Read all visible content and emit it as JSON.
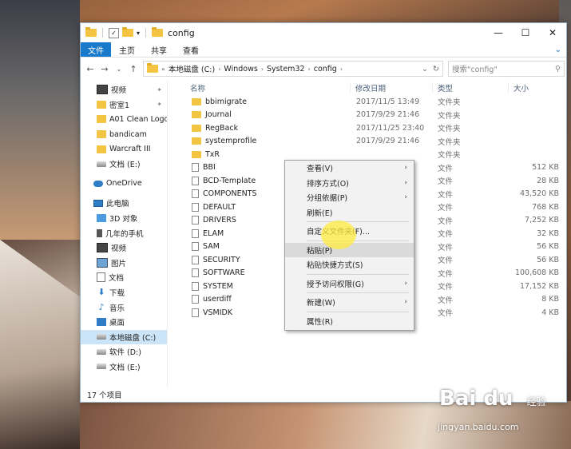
{
  "window": {
    "title": "config",
    "ribbon_tabs": [
      "主页",
      "共享",
      "查看"
    ],
    "file_tab": "文件",
    "controls": {
      "minimize": "—",
      "maximize": "☐",
      "close": "✕"
    }
  },
  "address": {
    "crumbs": [
      "本地磁盘 (C:)",
      "Windows",
      "System32",
      "config"
    ],
    "search_placeholder": "搜索\"config\""
  },
  "columns": {
    "name": "名称",
    "date": "修改日期",
    "type": "类型",
    "size": "大小"
  },
  "nav": [
    {
      "label": "视频",
      "icon": "video-icon",
      "pinned": true
    },
    {
      "label": "密室1",
      "icon": "folder-icon",
      "pinned": true
    },
    {
      "label": "A01 Clean Logo",
      "icon": "folder-icon"
    },
    {
      "label": "bandicam",
      "icon": "folder-icon"
    },
    {
      "label": "Warcraft III",
      "icon": "folder-icon"
    },
    {
      "label": "文档 (E:)",
      "icon": "drive-icon"
    },
    {
      "label": "OneDrive",
      "icon": "cloud-icon",
      "level0": true,
      "gap": true
    },
    {
      "label": "此电脑",
      "icon": "pc-icon",
      "level0": true,
      "gap": true
    },
    {
      "label": "3D 对象",
      "icon": "3d-objects-icon"
    },
    {
      "label": "几年的手机",
      "icon": "phone-icon"
    },
    {
      "label": "视频",
      "icon": "video-icon"
    },
    {
      "label": "图片",
      "icon": "pictures-icon"
    },
    {
      "label": "文档",
      "icon": "documents-icon"
    },
    {
      "label": "下载",
      "icon": "download-icon"
    },
    {
      "label": "音乐",
      "icon": "music-icon"
    },
    {
      "label": "桌面",
      "icon": "desktop-icon"
    },
    {
      "label": "本地磁盘 (C:)",
      "icon": "drive-icon",
      "selected": true
    },
    {
      "label": "软件 (D:)",
      "icon": "drive-icon"
    },
    {
      "label": "文档 (E:)",
      "icon": "drive-icon"
    }
  ],
  "files": [
    {
      "name": "bbimigrate",
      "date": "2017/11/5 13:49",
      "type": "文件夹",
      "size": "",
      "folder": true
    },
    {
      "name": "Journal",
      "date": "2017/9/29 21:46",
      "type": "文件夹",
      "size": "",
      "folder": true
    },
    {
      "name": "RegBack",
      "date": "2017/11/25 23:40",
      "type": "文件夹",
      "size": "",
      "folder": true
    },
    {
      "name": "systemprofile",
      "date": "2017/9/29 21:46",
      "type": "文件夹",
      "size": "",
      "folder": true
    },
    {
      "name": "TxR",
      "date": "",
      "type": "文件夹",
      "size": "",
      "folder": true
    },
    {
      "name": "BBI",
      "date": "",
      "type": "文件",
      "size": "512 KB"
    },
    {
      "name": "BCD-Template",
      "date": "",
      "type": "文件",
      "size": "28 KB"
    },
    {
      "name": "COMPONENTS",
      "date": "",
      "type": "文件",
      "size": "43,520 KB"
    },
    {
      "name": "DEFAULT",
      "date": "",
      "type": "文件",
      "size": "768 KB"
    },
    {
      "name": "DRIVERS",
      "date": "",
      "type": "文件",
      "size": "7,252 KB"
    },
    {
      "name": "ELAM",
      "date": "",
      "type": "文件",
      "size": "32 KB"
    },
    {
      "name": "SAM",
      "date": "",
      "type": "文件",
      "size": "56 KB"
    },
    {
      "name": "SECURITY",
      "date": "",
      "type": "文件",
      "size": "56 KB"
    },
    {
      "name": "SOFTWARE",
      "date": "",
      "type": "文件",
      "size": "100,608 KB"
    },
    {
      "name": "SYSTEM",
      "date": "",
      "type": "文件",
      "size": "17,152 KB"
    },
    {
      "name": "userdiff",
      "date": "",
      "type": "文件",
      "size": "8 KB"
    },
    {
      "name": "VSMIDK",
      "date": "",
      "type": "文件",
      "size": "4 KB"
    }
  ],
  "context_menu": [
    {
      "label": "查看(V)",
      "submenu": true
    },
    {
      "label": "排序方式(O)",
      "submenu": true
    },
    {
      "label": "分组依据(P)",
      "submenu": true
    },
    {
      "label": "刷新(E)"
    },
    {
      "sep": true
    },
    {
      "label": "自定义文件夹(F)..."
    },
    {
      "sep": true
    },
    {
      "label": "粘贴(P)",
      "highlight": true
    },
    {
      "label": "粘贴快捷方式(S)"
    },
    {
      "sep": true
    },
    {
      "label": "授予访问权限(G)",
      "submenu": true
    },
    {
      "sep": true
    },
    {
      "label": "新建(W)",
      "submenu": true
    },
    {
      "sep": true
    },
    {
      "label": "属性(R)"
    }
  ],
  "status": "17 个项目",
  "watermark": {
    "logo": "Bai du",
    "sub": "经验",
    "url": "jingyan.baidu.com"
  }
}
